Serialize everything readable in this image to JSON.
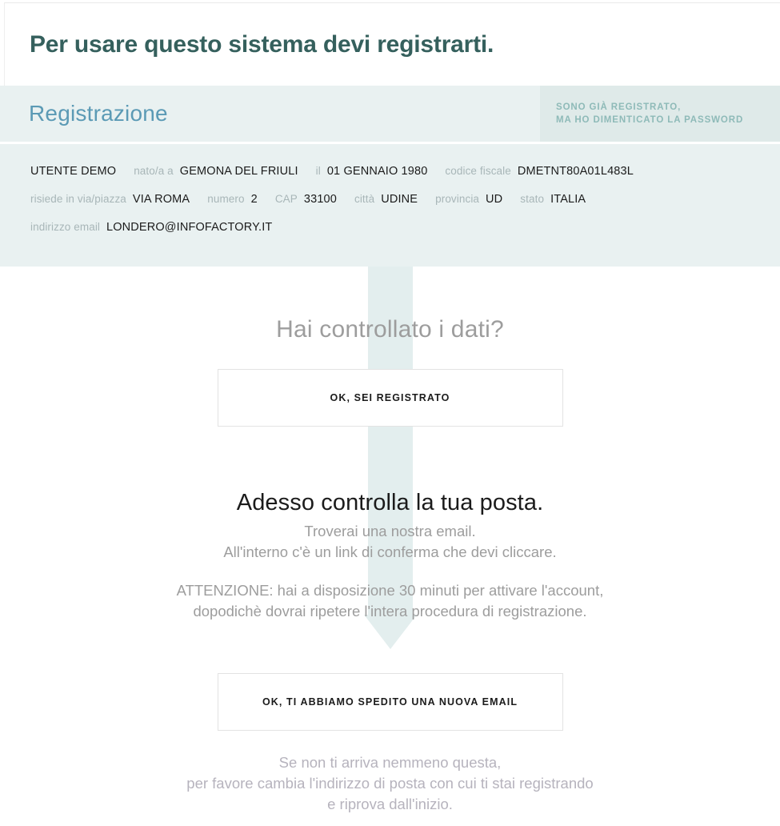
{
  "header": {
    "page_title": "Per usare questo sistema devi registrarti."
  },
  "tabs": {
    "active_tab_label": "Registrazione",
    "alt_tab_line1": "SONO GIÀ REGISTRATO,",
    "alt_tab_line2": "MA HO DIMENTICATO LA PASSWORD"
  },
  "registration_summary": {
    "rows": [
      {
        "fields": [
          {
            "label": "",
            "value": "UTENTE DEMO"
          },
          {
            "label": "nato/a a",
            "value": "GEMONA DEL FRIULI"
          },
          {
            "label": "il",
            "value": "01 GENNAIO 1980"
          },
          {
            "label": "codice fiscale",
            "value": "DMETNT80A01L483L"
          }
        ]
      },
      {
        "fields": [
          {
            "label": "risiede in via/piazza",
            "value": "VIA ROMA"
          },
          {
            "label": "numero",
            "value": "2"
          },
          {
            "label": "CAP",
            "value": "33100"
          },
          {
            "label": "città",
            "value": "UDINE"
          },
          {
            "label": "provincia",
            "value": "UD"
          },
          {
            "label": "stato",
            "value": "ITALIA"
          }
        ]
      },
      {
        "fields": [
          {
            "label": "indirizzo email",
            "value": "LONDERO@INFOFACTORY.IT"
          }
        ]
      }
    ]
  },
  "confirm": {
    "question": "Hai controllato i dati?",
    "confirm_button_label": "OK, SEI REGISTRATO"
  },
  "mail_check": {
    "headline": "Adesso controlla la tua posta.",
    "sub_line1": "Troverai una nostra email.",
    "sub_line2": "All'interno c'è un link di conferma che devi cliccare.",
    "warn_line1": "ATTENZIONE: hai a disposizione 30 minuti per attivare l'account,",
    "warn_line2": "dopodichè dovrai ripetere l'intera procedura di registrazione.",
    "resend_button_label": "OK, TI ABBIAMO SPEDITO UNA NUOVA EMAIL",
    "footer_line1": "Se non ti arriva nemmeno questa,",
    "footer_line2": "per favore cambia l'indirizzo di posta con cui ti stai registrando",
    "footer_line3": "e riprova dall'inizio."
  },
  "icons": {
    "down_arrow": "down-arrow-flow"
  },
  "colors": {
    "title_green": "#35605d",
    "panel_teal": "#e9f1f1",
    "alt_tab_teal": "#dfeae9",
    "tab_blue": "#5b9ab5",
    "muted_grey": "#9d9d9d",
    "label_grey": "#a8b6b8"
  }
}
